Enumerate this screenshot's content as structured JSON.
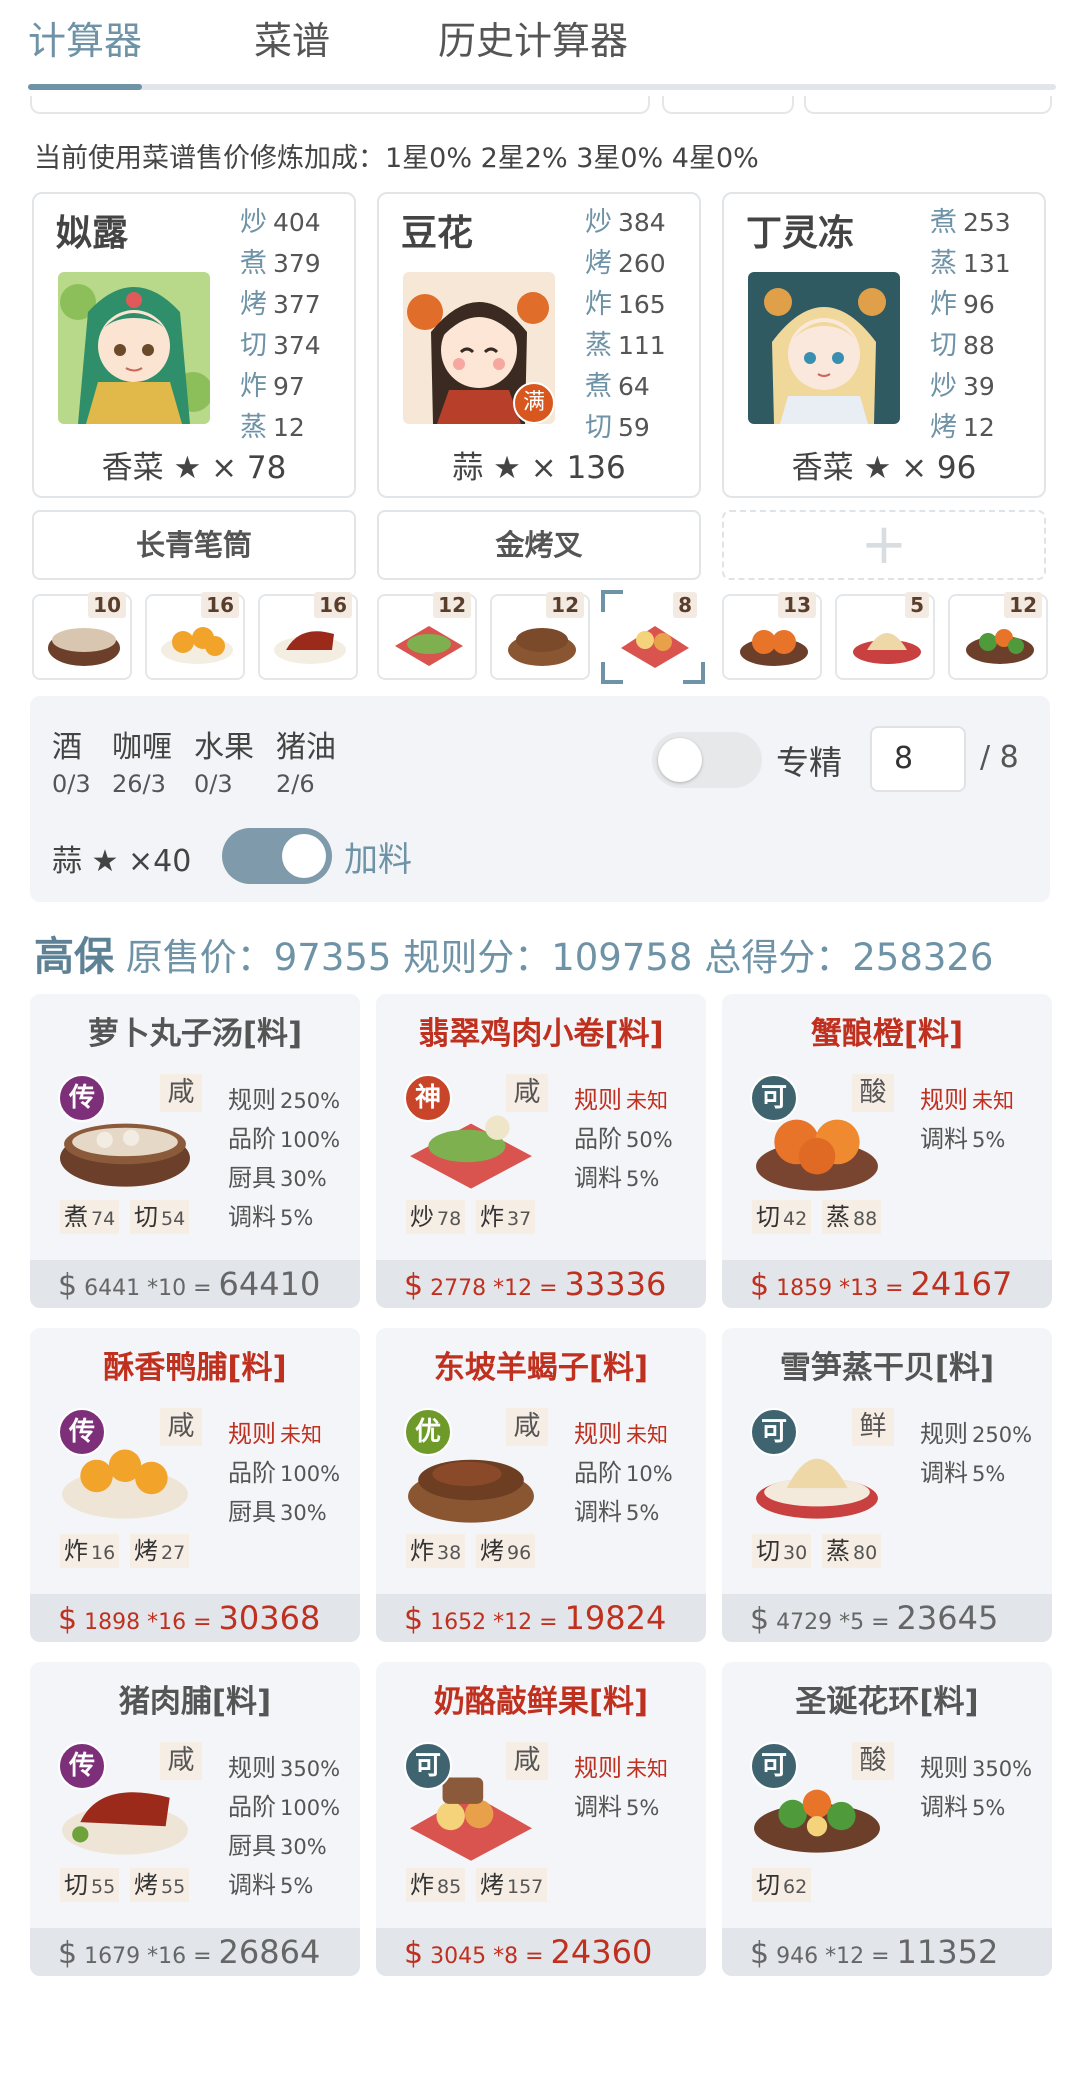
{
  "tabs": [
    {
      "label": "计算器",
      "active": true
    },
    {
      "label": "菜谱",
      "active": false
    },
    {
      "label": "历史计算器",
      "active": false
    }
  ],
  "bonus_text": "当前使用菜谱售价修炼加成：1星0% 2星2% 3星0% 4星0%",
  "chefs": [
    {
      "name": "姒露",
      "skills": [
        [
          "炒",
          "404"
        ],
        [
          "煮",
          "379"
        ],
        [
          "烤",
          "377"
        ],
        [
          "切",
          "374"
        ],
        [
          "炸",
          "97"
        ],
        [
          "蒸",
          "12"
        ]
      ],
      "footer": "香菜 ★ × 78"
    },
    {
      "name": "豆花",
      "skills": [
        [
          "炒",
          "384"
        ],
        [
          "烤",
          "260"
        ],
        [
          "炸",
          "165"
        ],
        [
          "蒸",
          "111"
        ],
        [
          "煮",
          "64"
        ],
        [
          "切",
          "59"
        ]
      ],
      "footer": "蒜 ★ × 136",
      "badge": "满"
    },
    {
      "name": "丁灵冻",
      "skills": [
        [
          "煮",
          "253"
        ],
        [
          "蒸",
          "131"
        ],
        [
          "炸",
          "96"
        ],
        [
          "切",
          "88"
        ],
        [
          "炒",
          "39"
        ],
        [
          "烤",
          "12"
        ]
      ],
      "footer": "香菜 ★ × 96"
    }
  ],
  "equipment": [
    "长青笔筒",
    "金烤叉",
    "+"
  ],
  "strip": [
    "10",
    "16",
    "16",
    "12",
    "12",
    "8",
    "13",
    "5",
    "12"
  ],
  "conditions": {
    "labels": [
      "酒",
      "咖喱",
      "水果",
      "猪油"
    ],
    "values": [
      "0/3",
      "26/3",
      "0/3",
      "2/6"
    ]
  },
  "mastery": {
    "label": "专精",
    "value": "8",
    "max": "/ 8"
  },
  "garlic": "蒜 ★ ×40",
  "extra_label": "加料",
  "summary": {
    "tag": "高保",
    "text": "原售价：97355 规则分：109758 总得分：258326"
  },
  "dishes": [
    {
      "title": "萝卜丸子汤[料]",
      "red": false,
      "rarity": "传",
      "taste": "咸",
      "stats": [
        [
          "规则",
          "250%",
          false
        ],
        [
          "品阶",
          "100%",
          false
        ],
        [
          "厨具",
          "30%",
          false
        ],
        [
          "调料",
          "5%",
          false
        ]
      ],
      "reqs": [
        [
          "煮",
          "74"
        ],
        [
          "切",
          "54"
        ]
      ],
      "price": "6441 *10",
      "total": "64410"
    },
    {
      "title": "翡翠鸡肉小卷[料]",
      "red": true,
      "rarity": "神",
      "taste": "咸",
      "stats": [
        [
          "规则",
          "未知",
          true
        ],
        [
          "品阶",
          "50%",
          false
        ],
        [
          "调料",
          "5%",
          false
        ]
      ],
      "reqs": [
        [
          "炒",
          "78"
        ],
        [
          "炸",
          "37"
        ]
      ],
      "price": "2778 *12",
      "total": "33336"
    },
    {
      "title": "蟹酿橙[料]",
      "red": true,
      "rarity": "可",
      "taste": "酸",
      "stats": [
        [
          "规则",
          "未知",
          true
        ],
        [
          "调料",
          "5%",
          false
        ]
      ],
      "reqs": [
        [
          "切",
          "42"
        ],
        [
          "蒸",
          "88"
        ]
      ],
      "price": "1859 *13",
      "total": "24167"
    },
    {
      "title": "酥香鸭脯[料]",
      "red": true,
      "rarity": "传",
      "taste": "咸",
      "stats": [
        [
          "规则",
          "未知",
          true
        ],
        [
          "品阶",
          "100%",
          false
        ],
        [
          "厨具",
          "30%",
          false
        ]
      ],
      "reqs": [
        [
          "炸",
          "16"
        ],
        [
          "烤",
          "27"
        ]
      ],
      "price": "1898 *16",
      "total": "30368"
    },
    {
      "title": "东坡羊蝎子[料]",
      "red": true,
      "rarity": "优",
      "taste": "咸",
      "stats": [
        [
          "规则",
          "未知",
          true
        ],
        [
          "品阶",
          "10%",
          false
        ],
        [
          "调料",
          "5%",
          false
        ]
      ],
      "reqs": [
        [
          "炸",
          "38"
        ],
        [
          "烤",
          "96"
        ]
      ],
      "price": "1652 *12",
      "total": "19824"
    },
    {
      "title": "雪笋蒸干贝[料]",
      "red": false,
      "rarity": "可",
      "taste": "鲜",
      "stats": [
        [
          "规则",
          "250%",
          false
        ],
        [
          "调料",
          "5%",
          false
        ]
      ],
      "reqs": [
        [
          "切",
          "30"
        ],
        [
          "蒸",
          "80"
        ]
      ],
      "price": "4729 *5",
      "total": "23645"
    },
    {
      "title": "猪肉脯[料]",
      "red": false,
      "rarity": "传",
      "taste": "咸",
      "stats": [
        [
          "规则",
          "350%",
          false
        ],
        [
          "品阶",
          "100%",
          false
        ],
        [
          "厨具",
          "30%",
          false
        ],
        [
          "调料",
          "5%",
          false
        ]
      ],
      "reqs": [
        [
          "切",
          "55"
        ],
        [
          "烤",
          "55"
        ]
      ],
      "price": "1679 *16",
      "total": "26864"
    },
    {
      "title": "奶酪敲鲜果[料]",
      "red": true,
      "rarity": "可",
      "taste": "咸",
      "stats": [
        [
          "规则",
          "未知",
          true
        ],
        [
          "调料",
          "5%",
          false
        ]
      ],
      "reqs": [
        [
          "炸",
          "85"
        ],
        [
          "烤",
          "157"
        ]
      ],
      "price": "3045 *8",
      "total": "24360"
    },
    {
      "title": "圣诞花环[料]",
      "red": false,
      "rarity": "可",
      "taste": "酸",
      "stats": [
        [
          "规则",
          "350%",
          false
        ],
        [
          "调料",
          "5%",
          false
        ]
      ],
      "reqs": [
        [
          "切",
          "62"
        ]
      ],
      "price": "946 *12",
      "total": "11352"
    }
  ],
  "colors": {
    "accent": "#6f93a6",
    "red": "#c0301f",
    "rarity_chuan": "#7d2f7a",
    "rarity_shen": "#c8452a",
    "rarity_ke": "#3f6470",
    "rarity_you": "#6e9a2a"
  }
}
